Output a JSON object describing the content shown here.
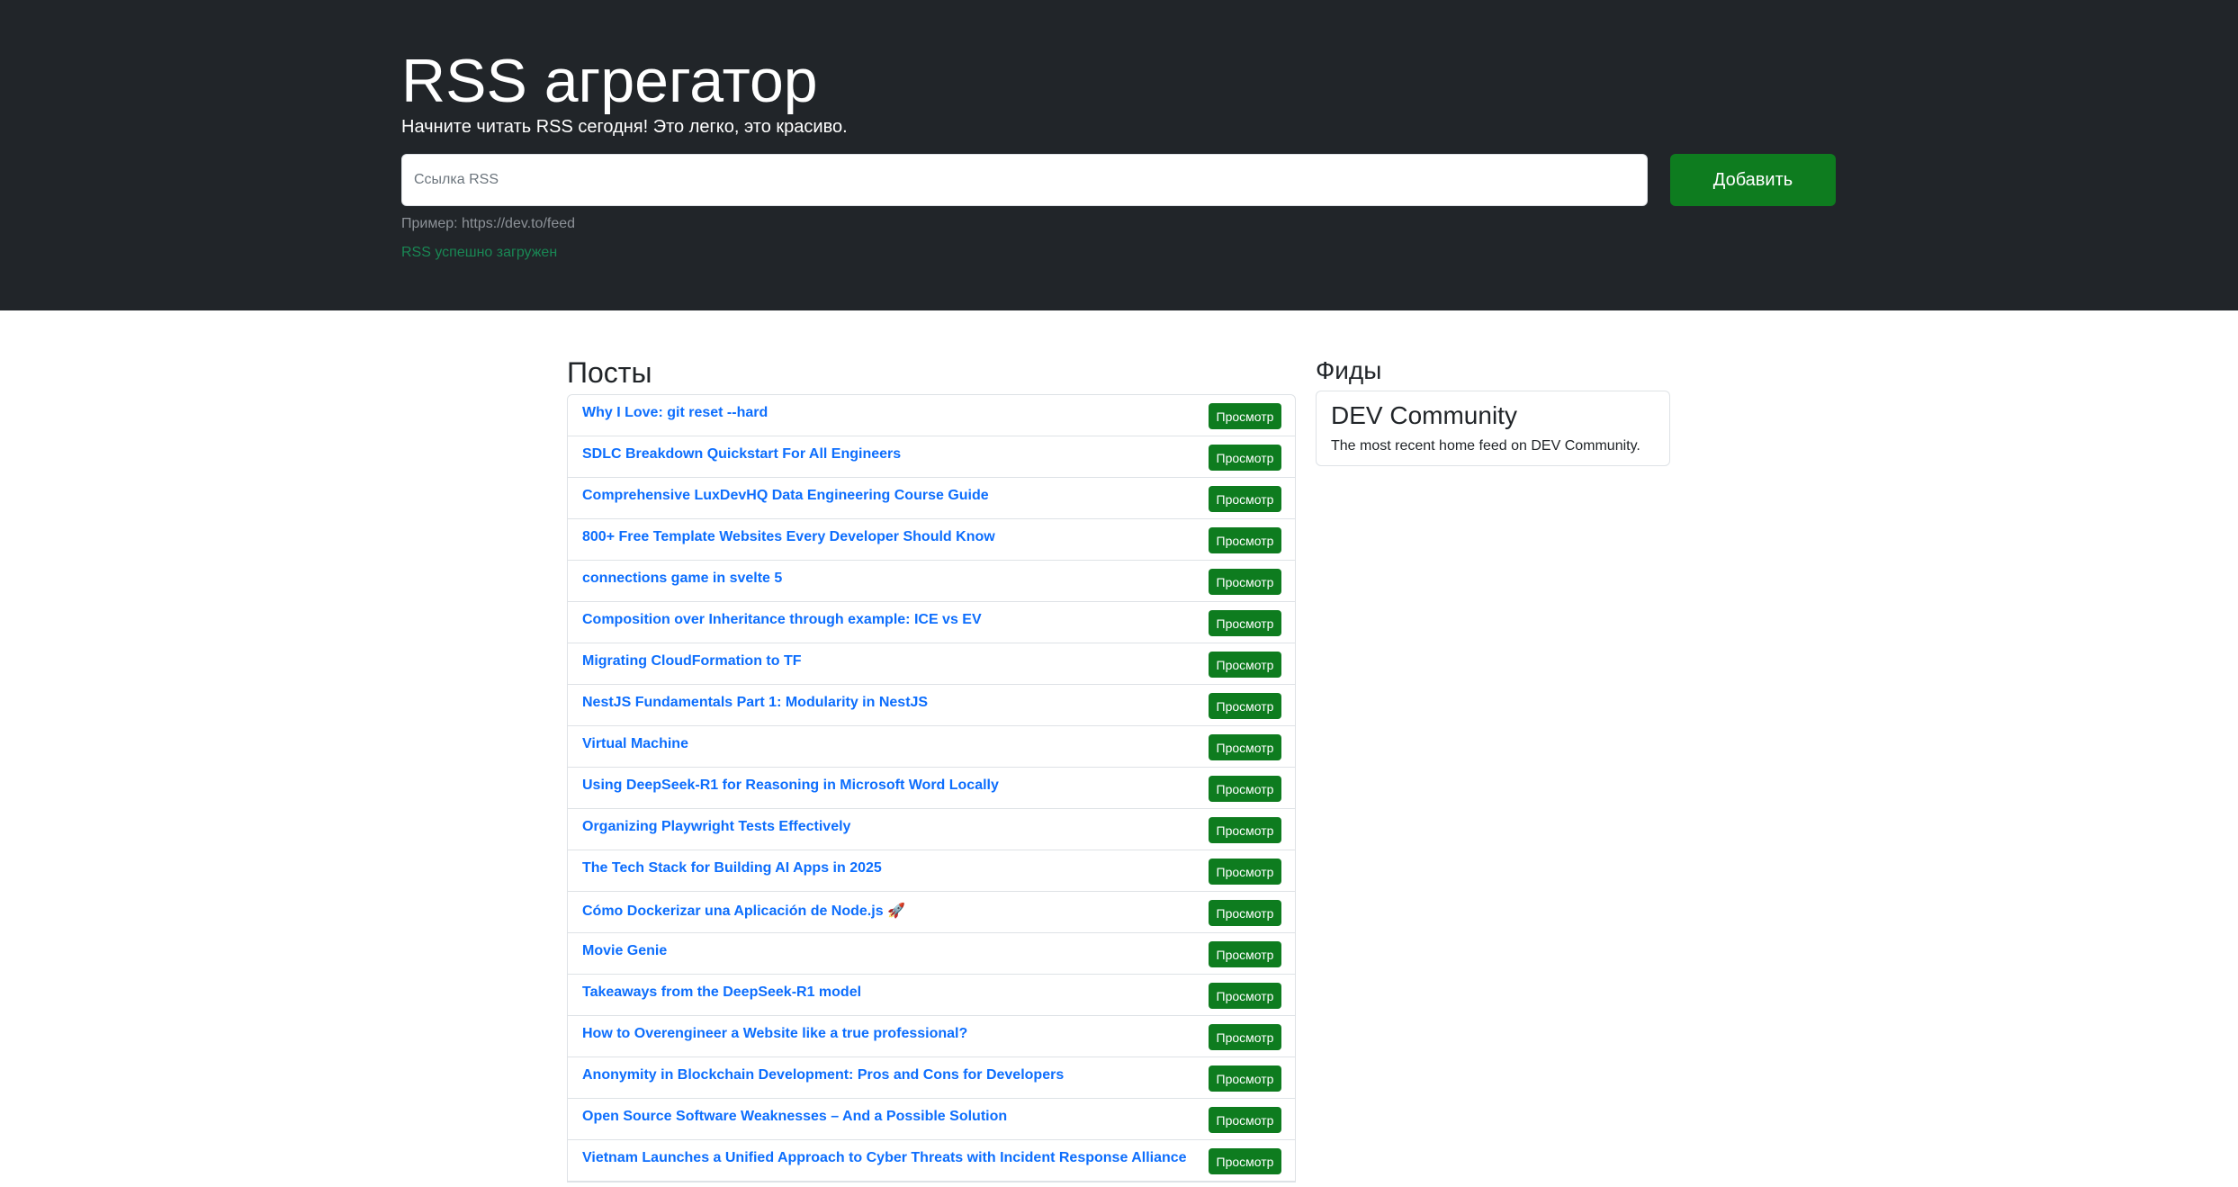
{
  "hero": {
    "title": "RSS агрегатор",
    "lead": "Начните читать RSS сегодня! Это легко, это красиво.",
    "input_placeholder": "Ссылка RSS",
    "input_value": "",
    "add_button_label": "Добавить",
    "example_hint": "Пример: https://dev.to/feed",
    "feedback": "RSS успешно загружен"
  },
  "posts": {
    "title": "Посты",
    "view_button_label": "Просмотр",
    "items": [
      "Why I Love: git reset --hard",
      "SDLC Breakdown Quickstart For All Engineers",
      "Comprehensive LuxDevHQ Data Engineering Course Guide",
      "800+ Free Template Websites Every Developer Should Know",
      "connections game in svelte 5",
      "Composition over Inheritance through example: ICE vs EV",
      "Migrating CloudFormation to TF",
      "NestJS Fundamentals Part 1: Modularity in NestJS",
      "Virtual Machine",
      "Using DeepSeek-R1 for Reasoning in Microsoft Word Locally",
      "Organizing Playwright Tests Effectively",
      "The Tech Stack for Building AI Apps in 2025",
      "Cómo Dockerizar una Aplicación de Node.js 🚀",
      "Movie Genie",
      "Takeaways from the DeepSeek-R1 model",
      "How to Overengineer a Website like a true professional?",
      "Anonymity in Blockchain Development: Pros and Cons for Developers",
      "Open Source Software Weaknesses – And a Possible Solution",
      "Vietnam Launches a Unified Approach to Cyber Threats with Incident Response Alliance"
    ]
  },
  "feeds": {
    "title": "Фиды",
    "items": [
      {
        "title": "DEV Community",
        "description": "The most recent home feed on DEV Community."
      }
    ]
  },
  "colors": {
    "hero_background": "#212529",
    "accent_green": "#0e7c1f",
    "link_blue": "#0d6efd",
    "success_text": "#198754"
  }
}
